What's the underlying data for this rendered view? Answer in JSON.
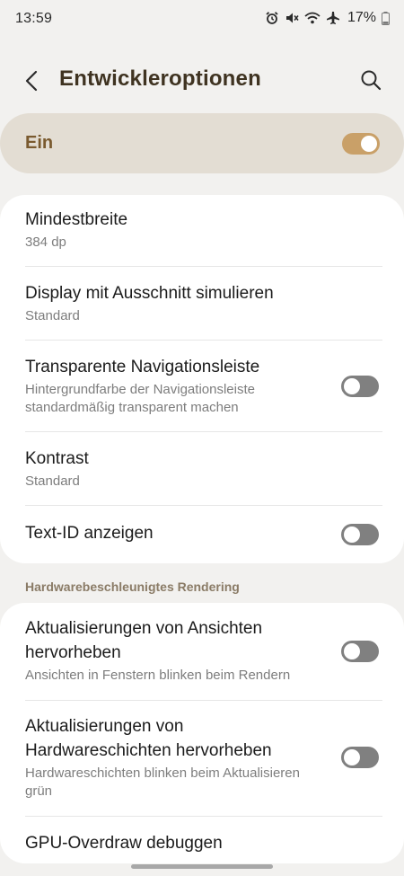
{
  "status": {
    "time": "13:59",
    "battery": "17%"
  },
  "appbar": {
    "title": "Entwickleroptionen"
  },
  "master": {
    "label": "Ein",
    "on": true
  },
  "card1": {
    "items": [
      {
        "title": "Mindestbreite",
        "subtitle": "384 dp"
      },
      {
        "title": "Display mit Ausschnitt simulieren",
        "subtitle": "Standard"
      },
      {
        "title": "Transparente Navigationsleiste",
        "subtitle_line1": "Hintergrundfarbe der Navigationsleiste",
        "subtitle_line2": "standardmäßig transparent machen",
        "on": false
      },
      {
        "title": "Kontrast",
        "subtitle": "Standard"
      },
      {
        "title": "Text-ID anzeigen",
        "on": false
      }
    ]
  },
  "section": {
    "header": "Hardwarebeschleunigtes Rendering"
  },
  "card2": {
    "items": [
      {
        "title_line1": "Aktualisierungen von Ansichten",
        "title_line2": "hervorheben",
        "subtitle": "Ansichten in Fenstern blinken beim Rendern",
        "on": false
      },
      {
        "title_line1": "Aktualisierungen von",
        "title_line2": "Hardwareschichten hervorheben",
        "subtitle_line1": "Hardwareschichten blinken beim Aktualisieren",
        "subtitle_line2": "grün",
        "on": false
      },
      {
        "title": "GPU-Overdraw debuggen"
      }
    ]
  },
  "colors": {
    "accent": "#c9a068",
    "title": "#3f3321",
    "master_bg": "#e3ddd3",
    "page_bg": "#f2f1ef"
  }
}
